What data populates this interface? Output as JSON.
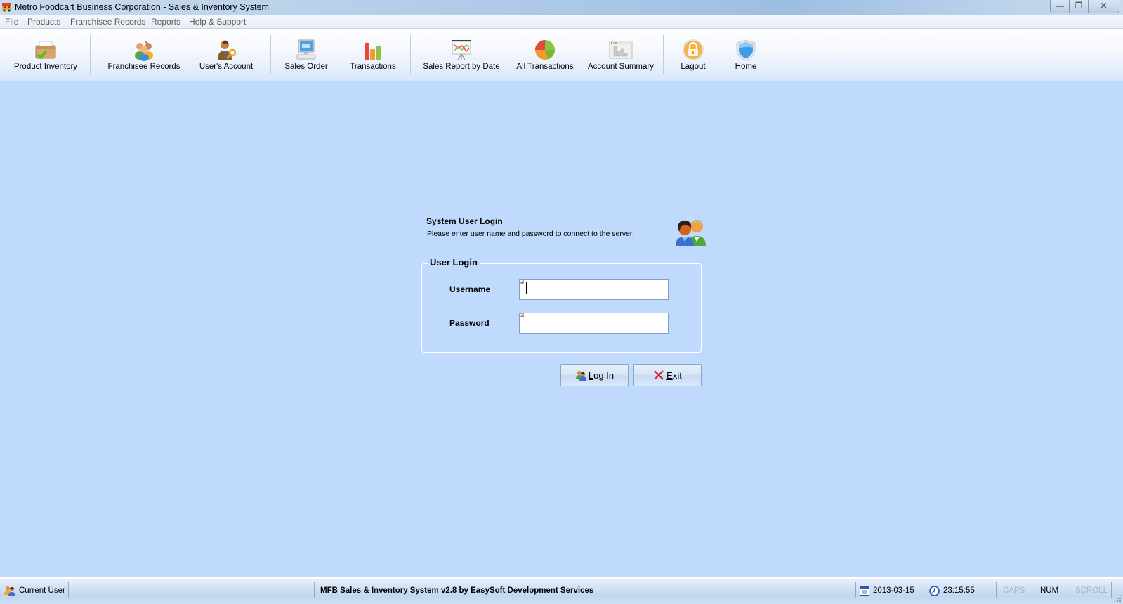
{
  "window": {
    "title": "Metro Foodcart Business Corporation - Sales & Inventory System",
    "controls": {
      "minimize": "—",
      "restore": "❐",
      "close": "✕"
    }
  },
  "menu": [
    "File",
    "Products",
    "Franchisee Records",
    "Reports",
    "Help & Support"
  ],
  "toolbar": [
    {
      "label": "Product Inventory",
      "icon": "inventory-box-icon"
    },
    {
      "label": "Franchisee Records",
      "icon": "people-group-icon"
    },
    {
      "label": "User's Account",
      "icon": "user-key-icon"
    },
    {
      "label": "Sales Order",
      "icon": "computer-icon"
    },
    {
      "label": "Transactions",
      "icon": "bar-chart-icon"
    },
    {
      "label": "Sales Report by Date",
      "icon": "line-chart-board-icon"
    },
    {
      "label": "All Transactions",
      "icon": "pie-chart-icon"
    },
    {
      "label": "Account Summary",
      "icon": "report-window-icon"
    },
    {
      "label": "Lagout",
      "icon": "padlock-icon"
    },
    {
      "label": "Home",
      "icon": "shield-icon"
    }
  ],
  "login": {
    "title": "System User Login",
    "description": "Please enter user name and password to connect to the server.",
    "group_label": "User Login",
    "username_label": "Username",
    "username_value": "",
    "password_label": "Password",
    "password_value": "",
    "login_button": {
      "accel": "L",
      "rest": "og In"
    },
    "exit_button": {
      "accel": "E",
      "rest": "xit"
    }
  },
  "status": {
    "current_user": "Current User",
    "app_info": "MFB Sales & Inventory System v2.8  by EasySoft Development Services",
    "date": "2013-03-15",
    "time": "23:15:55",
    "caps": "CAPS",
    "num": "NUM",
    "scroll": "SCROLL"
  },
  "colors": {
    "background": "#bfdafc",
    "exit_icon": "#d22424"
  }
}
